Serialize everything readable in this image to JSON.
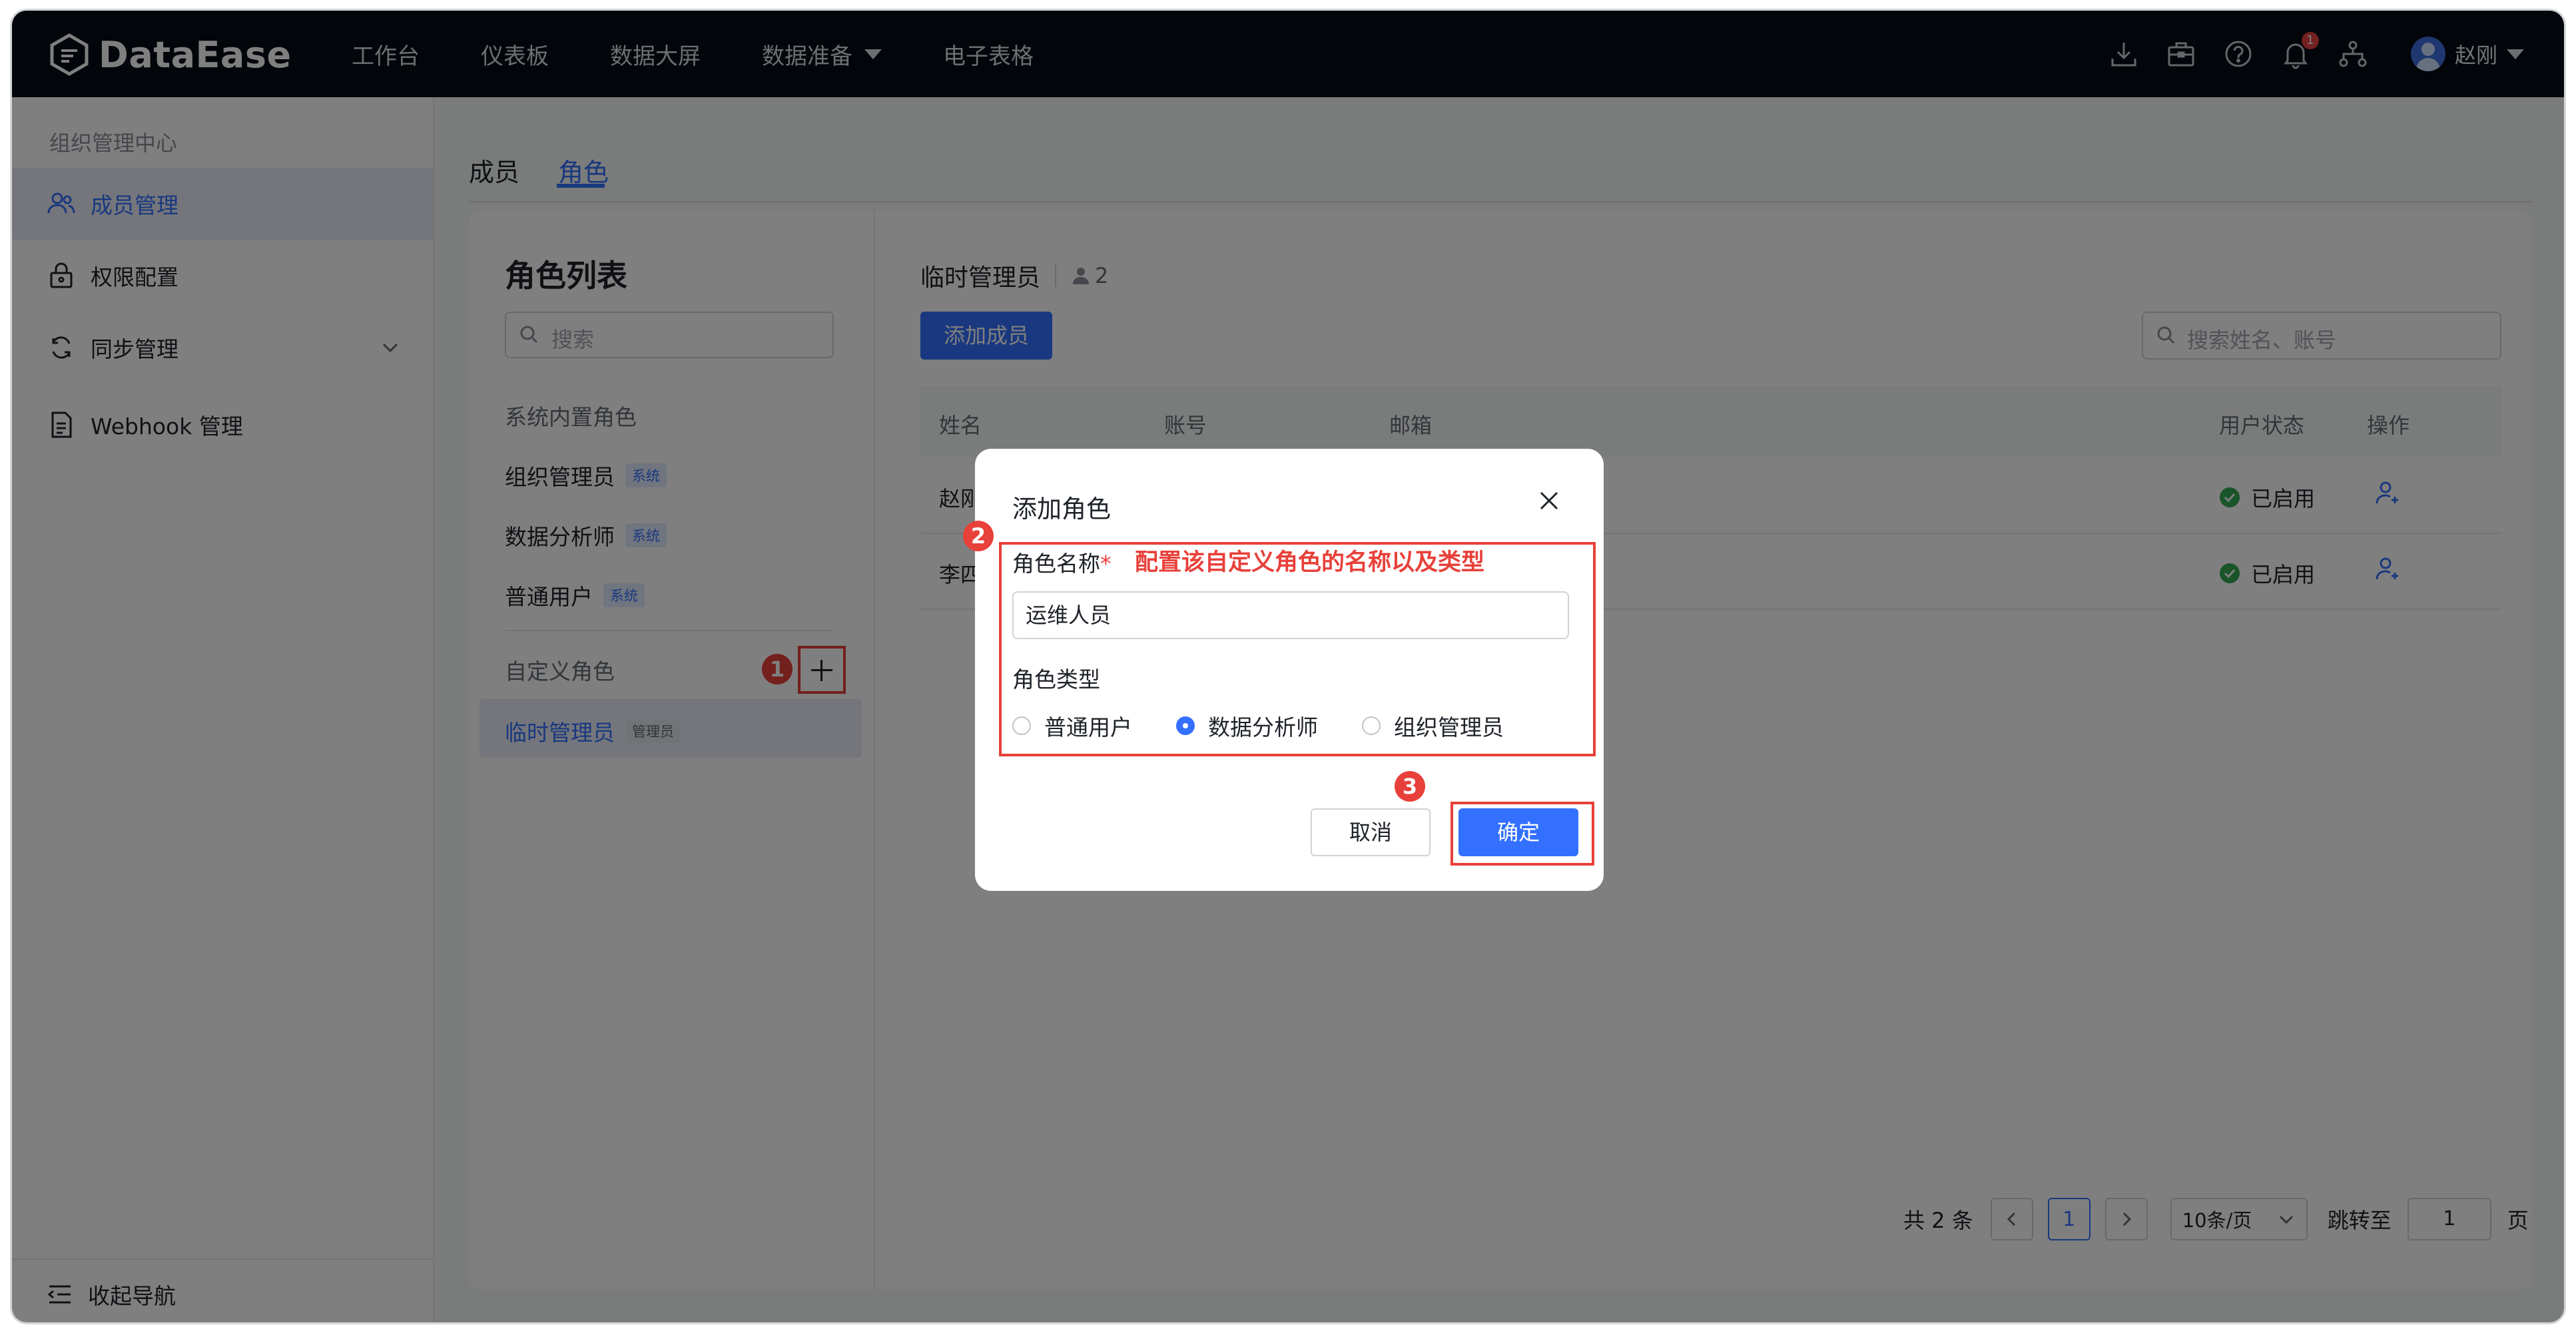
{
  "header": {
    "logo_text": "DataEase",
    "nav": [
      "工作台",
      "仪表板",
      "数据大屏",
      "数据准备",
      "电子表格"
    ],
    "notification_count": "1",
    "user_name": "赵刚"
  },
  "sidebar": {
    "title": "组织管理中心",
    "items": [
      {
        "label": "成员管理",
        "icon": "users-icon",
        "active": true
      },
      {
        "label": "权限配置",
        "icon": "lock-icon"
      },
      {
        "label": "同步管理",
        "icon": "sync-icon"
      },
      {
        "label": "Webhook 管理",
        "icon": "document-icon"
      }
    ],
    "collapse_label": "收起导航"
  },
  "tabs": [
    "成员",
    "角色"
  ],
  "role_list": {
    "title": "角色列表",
    "search_placeholder": "搜索",
    "builtin_label": "系统内置角色",
    "builtin_roles": [
      {
        "name": "组织管理员",
        "tag": "系统"
      },
      {
        "name": "数据分析师",
        "tag": "系统"
      },
      {
        "name": "普通用户",
        "tag": "系统"
      }
    ],
    "custom_label": "自定义角色",
    "custom_roles": [
      {
        "name": "临时管理员",
        "tag": "管理员"
      }
    ]
  },
  "members": {
    "role_title": "临时管理员",
    "member_count": "2",
    "add_button": "添加成员",
    "search_placeholder": "搜索姓名、账号",
    "columns": [
      "姓名",
      "账号",
      "邮箱",
      "用户状态",
      "操作"
    ],
    "rows": [
      {
        "name": "赵刚",
        "status": "已启用"
      },
      {
        "name": "李四",
        "status": "已启用"
      }
    ]
  },
  "pagination": {
    "total": "共 2 条",
    "current_page": "1",
    "page_size": "10条/页",
    "jump_label": "跳转至",
    "jump_value": "1",
    "page_suffix": "页"
  },
  "dialog": {
    "title": "添加角色",
    "name_label": "角色名称",
    "required_mark": "*",
    "annotation": "配置该自定义角色的名称以及类型",
    "name_value": "运维人员",
    "type_label": "角色类型",
    "type_options": [
      "普通用户",
      "数据分析师",
      "组织管理员"
    ],
    "selected_type": "数据分析师",
    "cancel": "取消",
    "confirm": "确定"
  },
  "callouts": [
    "1",
    "2",
    "3"
  ],
  "colors": {
    "accent": "#3370ff",
    "annotation_red": "#e8403a",
    "header_bg": "#050a14",
    "status_green": "#34a853"
  }
}
